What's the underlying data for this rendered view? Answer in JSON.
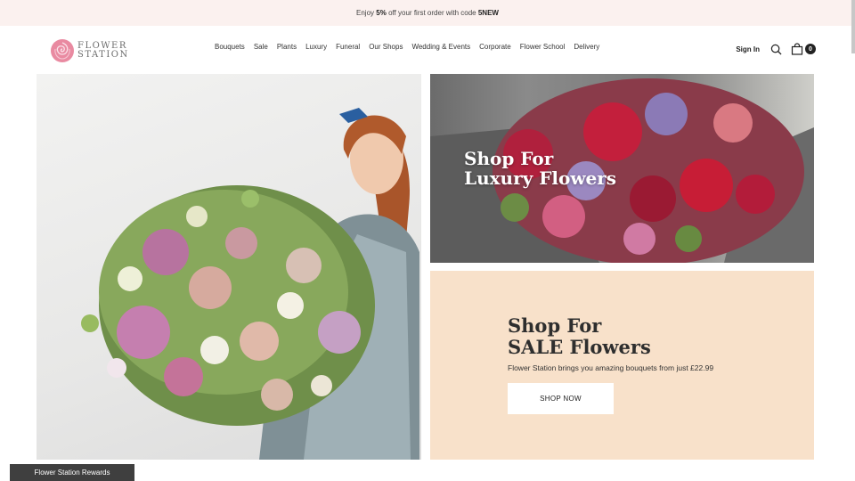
{
  "promo": {
    "prefix": "Enjoy ",
    "discount": "5%",
    "middle": " off your first order with code ",
    "code": "5NEW"
  },
  "logo": {
    "line1": "FLOWER",
    "line2": "STATION"
  },
  "nav": {
    "items": [
      "Bouquets",
      "Sale",
      "Plants",
      "Luxury",
      "Funeral",
      "Our Shops",
      "Wedding & Events",
      "Corporate",
      "Flower School",
      "Delivery"
    ]
  },
  "header": {
    "signin": "Sign In",
    "cart_count": "0"
  },
  "hero_luxury": {
    "line1": "Shop For",
    "line2": "Luxury Flowers"
  },
  "sale": {
    "line1": "Shop For",
    "line2": "SALE Flowers",
    "description": "Flower Station brings you amazing bouquets from just £22.99",
    "button": "SHOP NOW"
  },
  "rewards": {
    "label": "Flower Station Rewards"
  },
  "colors": {
    "promo_bg": "#fbf1ef",
    "sale_bg": "#f8e1ca",
    "rewards_bg": "#3f3f3f",
    "logo_pink": "#e98aa1"
  },
  "icons": [
    "rose-logo-icon",
    "search-icon",
    "shopping-bag-icon"
  ]
}
